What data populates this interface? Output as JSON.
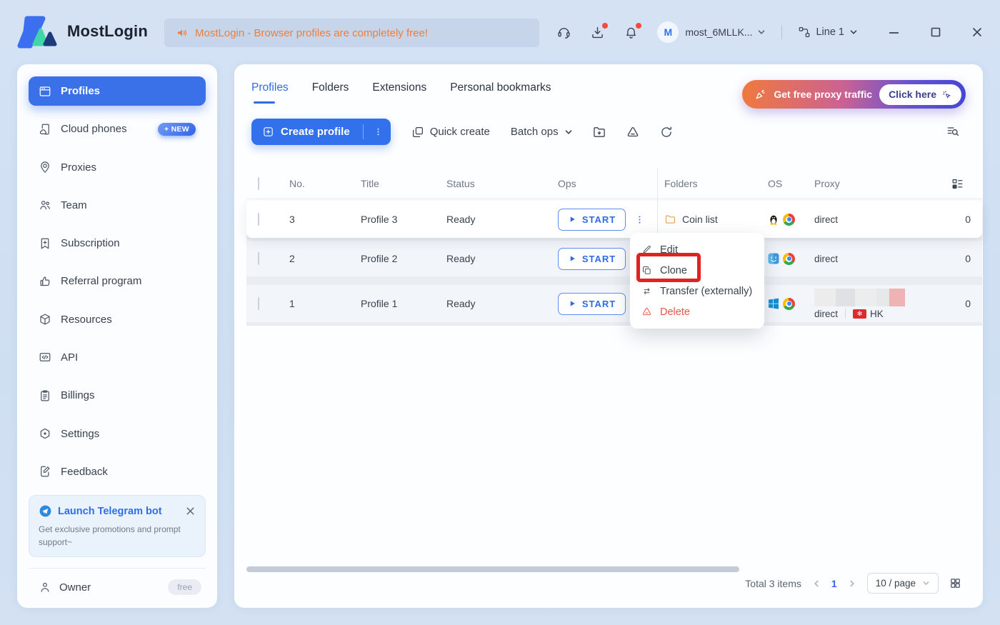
{
  "colors": {
    "accent_blue": "#3370eb",
    "announce_orange": "#ee7e3c",
    "danger_red": "#e2574c",
    "annotation_red": "#e12222",
    "promo_gradient_start": "#f0793e",
    "promo_gradient_end": "#4447d5"
  },
  "topbar": {
    "brand": "MostLogin",
    "announcement": "MostLogin - Browser profiles are completely free!",
    "avatar_initial": "M",
    "user_name": "most_6MLLK...",
    "line_selector": "Line 1"
  },
  "sidebar": {
    "items": [
      {
        "label": "Profiles",
        "active": true
      },
      {
        "label": "Cloud phones",
        "badge": "+ NEW"
      },
      {
        "label": "Proxies"
      },
      {
        "label": "Team"
      },
      {
        "label": "Subscription"
      },
      {
        "label": "Referral program"
      },
      {
        "label": "Resources"
      },
      {
        "label": "API"
      },
      {
        "label": "Billings"
      },
      {
        "label": "Settings"
      },
      {
        "label": "Feedback"
      }
    ],
    "telegram_card": {
      "title": "Launch Telegram bot",
      "description": "Get exclusive promotions and prompt support~"
    },
    "owner": {
      "label": "Owner",
      "badge": "free"
    }
  },
  "main": {
    "tabs": [
      {
        "label": "Profiles",
        "active": true
      },
      {
        "label": "Folders"
      },
      {
        "label": "Extensions"
      },
      {
        "label": "Personal bookmarks"
      }
    ],
    "promo": {
      "text": "Get free proxy traffic",
      "button": "Click here"
    },
    "toolbar": {
      "create_profile": "Create profile",
      "quick_create": "Quick create",
      "batch_ops": "Batch ops"
    },
    "table": {
      "columns": {
        "no": "No.",
        "title": "Title",
        "status": "Status",
        "ops": "Ops",
        "folders": "Folders",
        "os": "OS",
        "proxy": "Proxy"
      },
      "rows": [
        {
          "no": "3",
          "title": "Profile 3",
          "status": "Ready",
          "start_label": "START",
          "folder": "Coin list",
          "os": "linux, chrome",
          "proxy": "direct",
          "count": "0"
        },
        {
          "no": "2",
          "title": "Profile 2",
          "status": "Ready",
          "start_label": "START",
          "os": "macos, chrome",
          "proxy": "direct",
          "count": "0"
        },
        {
          "no": "1",
          "title": "Profile 1",
          "status": "Ready",
          "start_label": "START",
          "os": "windows, chrome",
          "proxy": "direct",
          "proxy_region": "HK",
          "count": "0",
          "proxy_censored": true
        }
      ]
    },
    "context_menu": {
      "items": [
        {
          "label": "Edit"
        },
        {
          "label": "Clone",
          "highlighted": true
        },
        {
          "label": "Transfer (externally)"
        },
        {
          "label": "Delete",
          "danger": true
        }
      ]
    },
    "pagination": {
      "total": "Total 3 items",
      "current_page": "1",
      "page_size": "10 / page"
    }
  }
}
